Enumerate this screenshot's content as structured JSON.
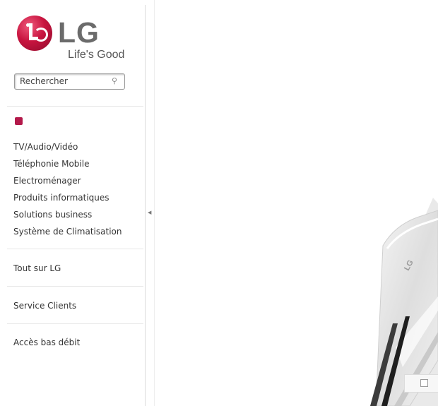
{
  "logo": {
    "brand": "LG",
    "tagline": "Life's Good"
  },
  "search": {
    "placeholder": "Rechercher",
    "icon": "search-icon"
  },
  "nav": {
    "products": [
      {
        "label": "TV/Audio/Vidéo"
      },
      {
        "label": "Téléphonie Mobile"
      },
      {
        "label": "Electroménager"
      },
      {
        "label": "Produits informatiques"
      },
      {
        "label": "Solutions business"
      },
      {
        "label": "Système de Climatisation"
      }
    ],
    "about": "Tout sur LG",
    "support": "Service Clients",
    "low_bandwidth": "Accès bas débit"
  },
  "phone_brand": "LG",
  "colors": {
    "brand": "#b3194a",
    "text": "#333333",
    "divider": "#dcdcdc"
  }
}
